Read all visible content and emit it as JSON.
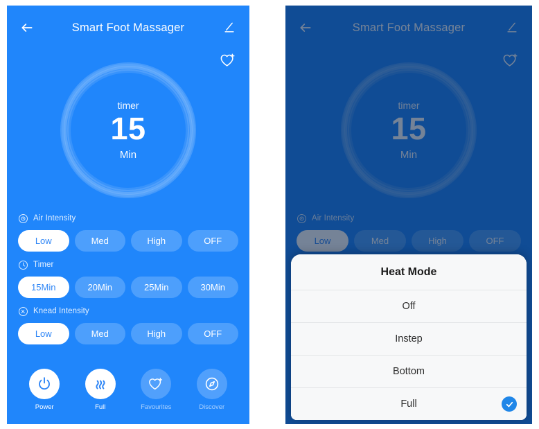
{
  "app": {
    "title": "Smart Foot Massager",
    "theme": {
      "bg_blue": "#2086FB",
      "bg_dim_blue": "#154A82",
      "pill_inactive": "#4D9FFC",
      "pill_active_bg": "#ffffff",
      "pill_active_text": "#2F86F6",
      "sheet_bg": "#F7F8F9",
      "check_blue": "#1F86E8"
    },
    "icons": {
      "back": "back-arrow-icon",
      "edit": "pencil-edit-icon",
      "favourite_add": "heart-plus-icon"
    }
  },
  "dial": {
    "label": "timer",
    "value": "15",
    "unit": "Min"
  },
  "groups": [
    {
      "key": "air_intensity",
      "title": "Air Intensity",
      "icon": "air-intensity-icon",
      "options": [
        {
          "label": "Low",
          "active": true
        },
        {
          "label": "Med",
          "active": false
        },
        {
          "label": "High",
          "active": false
        },
        {
          "label": "OFF",
          "active": false
        }
      ]
    },
    {
      "key": "timer",
      "title": "Timer",
      "icon": "clock-icon",
      "options": [
        {
          "label": "15Min",
          "active": true
        },
        {
          "label": "20Min",
          "active": false
        },
        {
          "label": "25Min",
          "active": false
        },
        {
          "label": "30Min",
          "active": false
        }
      ]
    },
    {
      "key": "knead_intensity",
      "title": "Knead Intensity",
      "icon": "knead-intensity-icon",
      "options": [
        {
          "label": "Low",
          "active": true
        },
        {
          "label": "Med",
          "active": false
        },
        {
          "label": "High",
          "active": false
        },
        {
          "label": "OFF",
          "active": false
        }
      ]
    }
  ],
  "bottom_nav": [
    {
      "label": "Power",
      "icon": "power-icon",
      "active": true
    },
    {
      "label": "Full",
      "icon": "heat-waves-icon",
      "active": true
    },
    {
      "label": "Favourites",
      "icon": "heart-plus-icon",
      "active": false
    },
    {
      "label": "Discover",
      "icon": "compass-icon",
      "active": false
    }
  ],
  "sheet": {
    "title": "Heat Mode",
    "options": [
      {
        "label": "Off",
        "selected": false
      },
      {
        "label": "Instep",
        "selected": false
      },
      {
        "label": "Bottom",
        "selected": false
      },
      {
        "label": "Full",
        "selected": true
      }
    ]
  }
}
